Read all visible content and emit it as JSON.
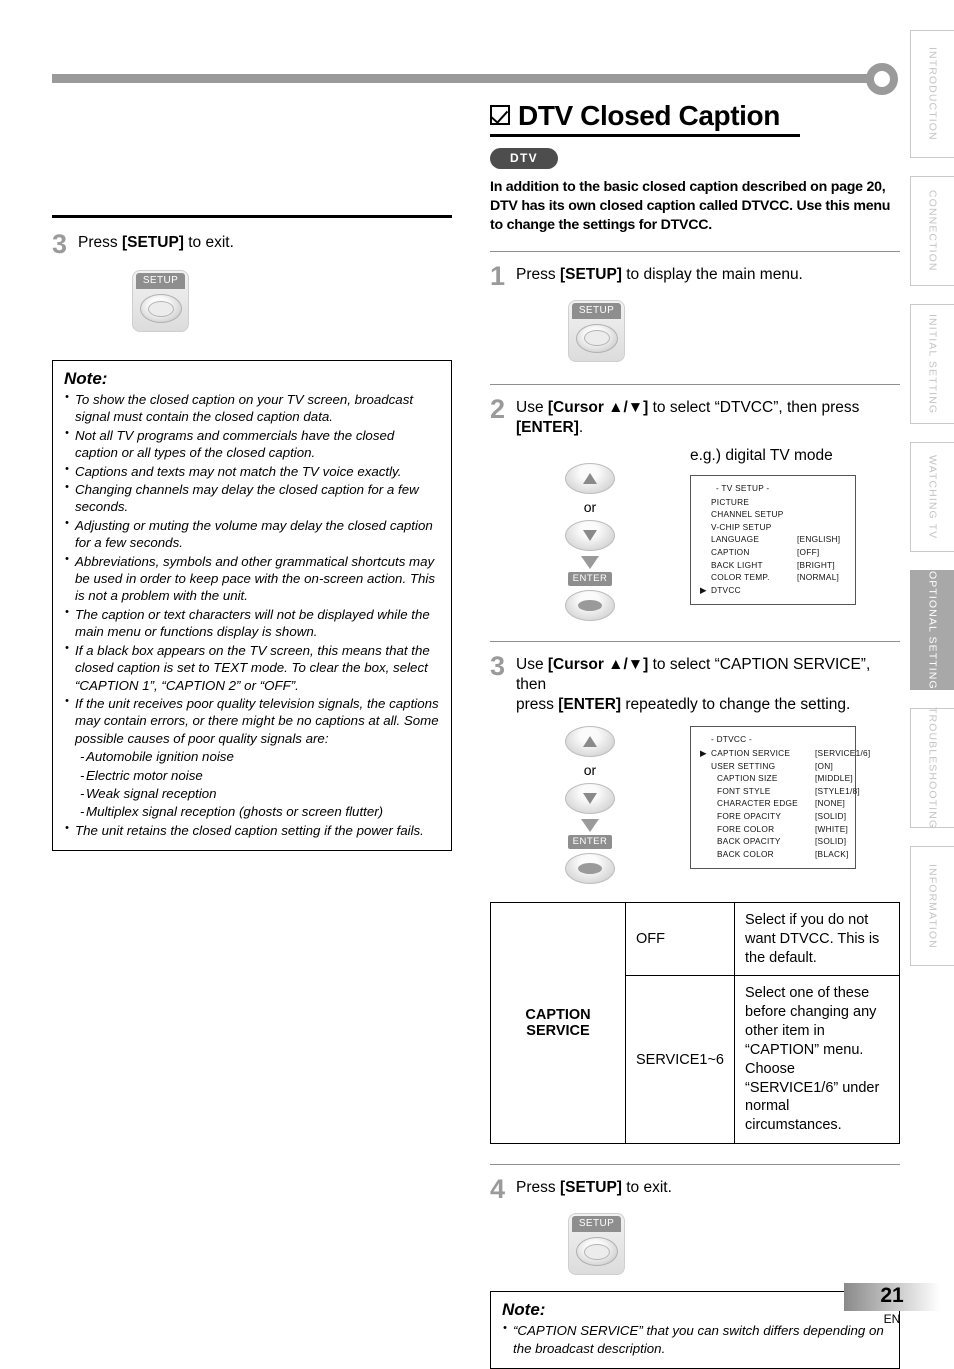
{
  "heading": {
    "title": "DTV Closed Caption",
    "badge": "DTV",
    "intro": "In addition to the basic closed caption described on page 20, DTV has its own closed caption called DTVCC. Use this menu to change the settings for DTVCC."
  },
  "tabs": [
    {
      "label": "INTRODUCTION",
      "active": false
    },
    {
      "label": "CONNECTION",
      "active": false
    },
    {
      "label": "INITIAL  SETTING",
      "active": false
    },
    {
      "label": "WATCHING  TV",
      "active": false
    },
    {
      "label": "OPTIONAL  SETTING",
      "active": true
    },
    {
      "label": "TROUBLESHOOTING",
      "active": false
    },
    {
      "label": "INFORMATION",
      "active": false
    }
  ],
  "left_column": {
    "step3": {
      "number": "3",
      "text_before": "Press ",
      "text_bold": "[SETUP]",
      "text_after": " to exit.",
      "key_label": "SETUP"
    },
    "note": {
      "title": "Note:",
      "items": [
        {
          "text": "To show the closed caption on your TV screen, broadcast signal must contain the closed caption data.",
          "sub": false
        },
        {
          "text": "Not all TV programs and commercials have the closed caption or all types of the closed caption.",
          "sub": false
        },
        {
          "text": "Captions and texts may not match the TV voice exactly.",
          "sub": false
        },
        {
          "text": "Changing channels may delay the closed caption for a few seconds.",
          "sub": false
        },
        {
          "text": "Adjusting or muting the volume may delay the closed caption for a few seconds.",
          "sub": false
        },
        {
          "text": "Abbreviations, symbols and other grammatical shortcuts may be used in order to keep pace with the on-screen action. This is not a problem with the unit.",
          "sub": false
        },
        {
          "text": "The caption or text characters will not be displayed while the main menu or functions display is shown.",
          "sub": false
        },
        {
          "text": "If a black box appears on the TV screen, this means that the closed caption is set to TEXT mode. To clear the box, select “CAPTION 1”, “CAPTION 2” or “OFF”.",
          "sub": false
        },
        {
          "text": "If the unit receives poor quality television signals, the captions may contain errors, or there might be no captions at all. Some possible causes of poor quality signals are:",
          "sub": false
        },
        {
          "text": "Automobile ignition noise",
          "sub": true
        },
        {
          "text": "Electric motor noise",
          "sub": true
        },
        {
          "text": "Weak signal reception",
          "sub": true
        },
        {
          "text": "Multiplex signal reception (ghosts or screen flutter)",
          "sub": true
        },
        {
          "text": "The unit retains the closed caption setting if the power fails.",
          "sub": false
        }
      ]
    }
  },
  "right_column": {
    "step1": {
      "number": "1",
      "text_before": "Press ",
      "text_bold": "[SETUP]",
      "text_after": " to display the main menu.",
      "key_label": "SETUP"
    },
    "step2": {
      "number": "2",
      "line1_before": "Use ",
      "line1_bold": "[Cursor ▲/▼]",
      "line1_after": " to select “DTVCC”, then press",
      "line2_bold": "[ENTER]",
      "line2_after": ".",
      "or_label": "or",
      "enter_label": "ENTER",
      "example_label": "e.g.) digital TV mode",
      "osd": {
        "title": "-  TV SETUP  -",
        "rows": [
          {
            "mark": "",
            "label": "PICTURE",
            "value": ""
          },
          {
            "mark": "",
            "label": "CHANNEL SETUP",
            "value": ""
          },
          {
            "mark": "",
            "label": "V-CHIP  SETUP",
            "value": ""
          },
          {
            "mark": "",
            "label": "LANGUAGE",
            "value": "[ENGLISH]"
          },
          {
            "mark": "",
            "label": "CAPTION",
            "value": "[OFF]"
          },
          {
            "mark": "",
            "label": "BACK  LIGHT",
            "value": "[BRIGHT]"
          },
          {
            "mark": "",
            "label": "COLOR  TEMP.",
            "value": "[NORMAL]"
          },
          {
            "mark": "▶",
            "label": "DTVCC",
            "value": ""
          }
        ]
      }
    },
    "step3": {
      "number": "3",
      "line1_before": "Use ",
      "line1_bold": "[Cursor ▲/▼]",
      "line1_after": " to select “CAPTION SERVICE”, then",
      "line2_before": "press ",
      "line2_bold": "[ENTER]",
      "line2_after": " repeatedly to change the setting.",
      "or_label": "or",
      "enter_label": "ENTER",
      "osd": {
        "title": "- DTVCC -",
        "rows": [
          {
            "mark": "▶",
            "label": "CAPTION SERVICE",
            "value": "[SERVICE1/6]",
            "indent": false
          },
          {
            "mark": "",
            "label": "USER SETTING",
            "value": "[ON]",
            "indent": false
          },
          {
            "mark": "",
            "label": "CAPTION SIZE",
            "value": "[MIDDLE]",
            "indent": true
          },
          {
            "mark": "",
            "label": "FONT STYLE",
            "value": "[STYLE1/8]",
            "indent": true
          },
          {
            "mark": "",
            "label": "CHARACTER EDGE",
            "value": "[NONE]",
            "indent": true
          },
          {
            "mark": "",
            "label": "FORE OPACITY",
            "value": "[SOLID]",
            "indent": true
          },
          {
            "mark": "",
            "label": "FORE COLOR",
            "value": "[WHITE]",
            "indent": true
          },
          {
            "mark": "",
            "label": "BACK OPACITY",
            "value": "[SOLID]",
            "indent": true
          },
          {
            "mark": "",
            "label": "BACK COLOR",
            "value": "[BLACK]",
            "indent": true
          }
        ]
      }
    },
    "caption_table": {
      "name": "CAPTION SERVICE",
      "rows": [
        {
          "option": "OFF",
          "description": "Select if you do not want DTVCC. This is the default."
        },
        {
          "option": "SERVICE1~6",
          "description": "Select one of these before changing any other item in “CAPTION” menu. Choose “SERVICE1/6” under normal circumstances."
        }
      ]
    },
    "step4": {
      "number": "4",
      "text_before": "Press ",
      "text_bold": "[SETUP]",
      "text_after": " to exit.",
      "key_label": "SETUP"
    },
    "note": {
      "title": "Note:",
      "items": [
        {
          "text": "“CAPTION SERVICE” that you can switch differs depending on the broadcast description.",
          "sub": false
        }
      ]
    }
  },
  "footer": {
    "page_number": "21",
    "language": "EN"
  }
}
